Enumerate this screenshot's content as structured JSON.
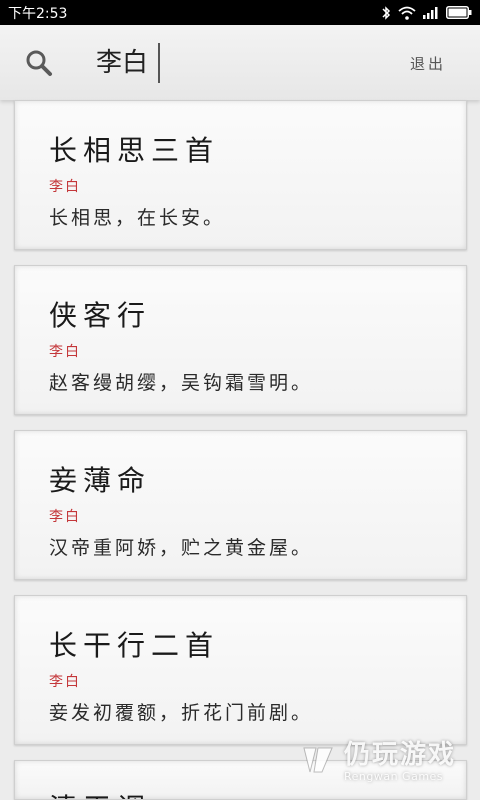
{
  "status_bar": {
    "time": "下午2:53"
  },
  "search": {
    "query": "李白",
    "logout_label": "退出"
  },
  "poems": [
    {
      "title": "长相思三首",
      "author": "李白",
      "first_line": "长相思，在长安。"
    },
    {
      "title": "侠客行",
      "author": "李白",
      "first_line": "赵客缦胡缨，吴钩霜雪明。"
    },
    {
      "title": "妾薄命",
      "author": "李白",
      "first_line": "汉帝重阿娇，贮之黄金屋。"
    },
    {
      "title": "长干行二首",
      "author": "李白",
      "first_line": "妾发初覆额，折花门前剧。"
    },
    {
      "title": "清平调"
    }
  ],
  "watermark": {
    "chinese": "仍玩游戏",
    "english": "Rengwan Games"
  },
  "colors": {
    "author_red": "#c4373a",
    "background": "#ececec"
  }
}
